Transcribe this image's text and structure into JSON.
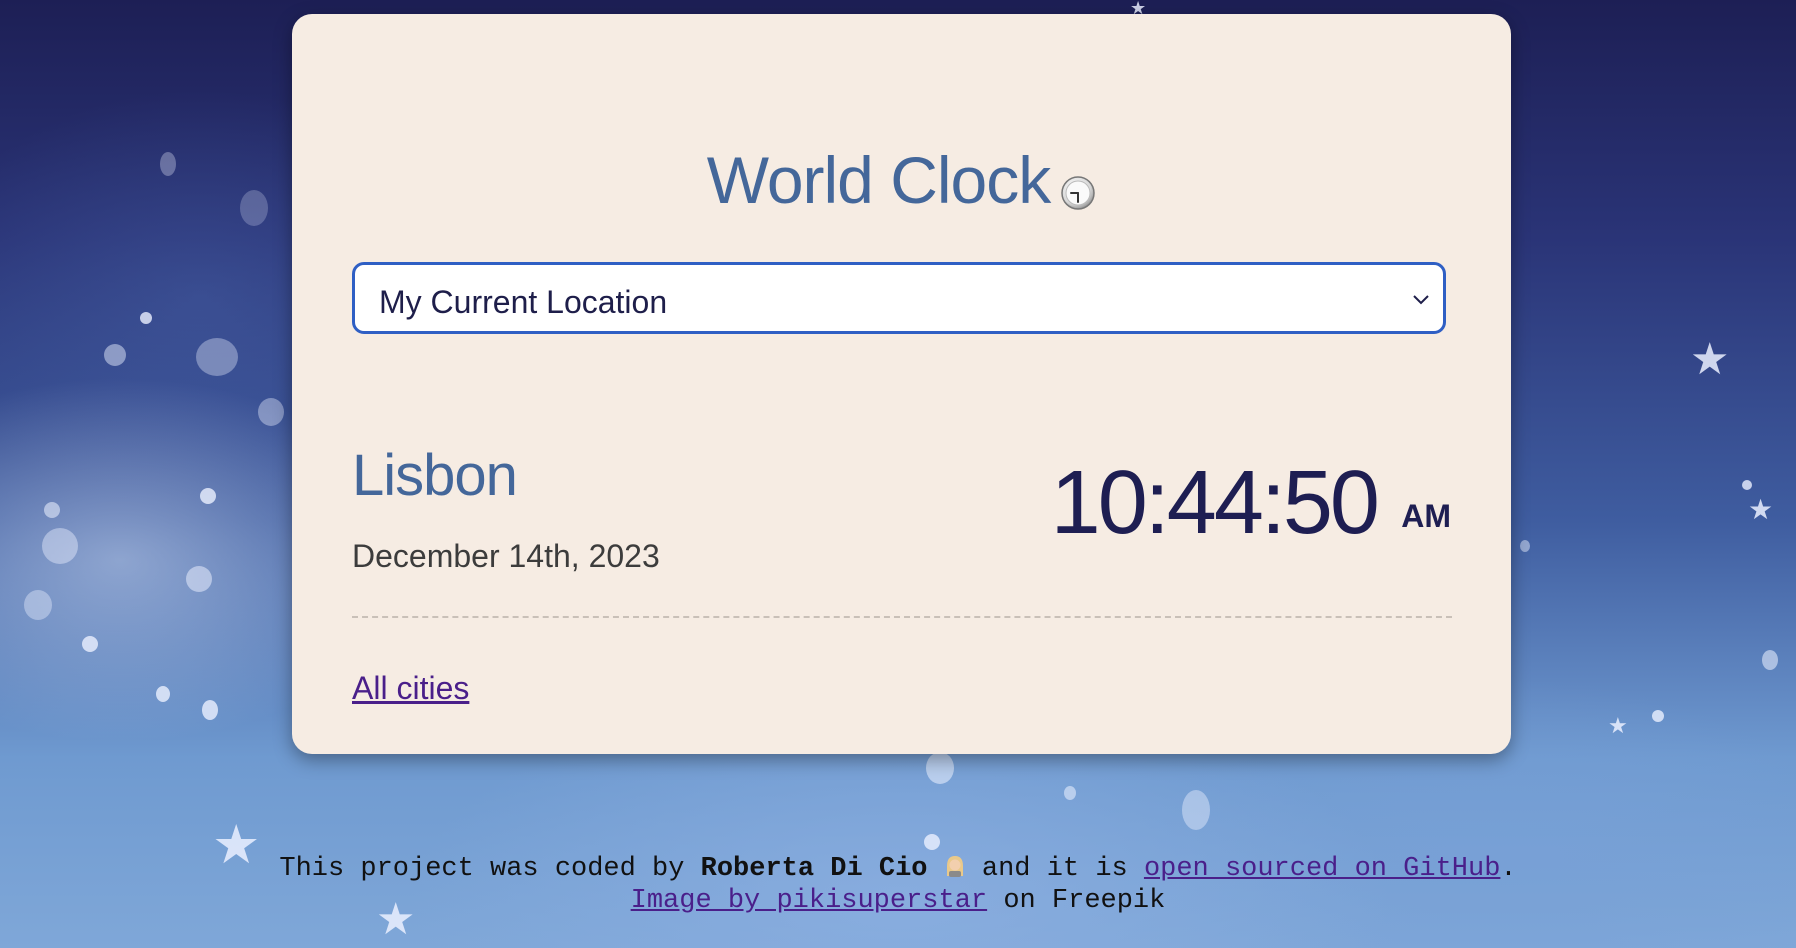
{
  "page": {
    "title": "World Clock",
    "title_icon": "clock-icon",
    "colors": {
      "card_background": "#f6ece3",
      "title": "#44679a",
      "time": "#1e1e52",
      "select_border": "#2f5fc4",
      "link": "#4a1f8a"
    }
  },
  "city_select": {
    "selected": "My Current Location",
    "icon": "chevron-down-icon"
  },
  "clock": {
    "city": "Lisbon",
    "date": "December 14th, 2023",
    "time": "10:44:50",
    "ampm": "AM"
  },
  "nav": {
    "all_cities": "All cities"
  },
  "footer": {
    "line1_prefix": "This project was coded by",
    "author": "Roberta Di Cio",
    "author_icon": "person-emoji-icon",
    "line1_middle": "and it is",
    "github_link": "open sourced on GitHub",
    "line1_suffix": ".",
    "image_credit_link": "Image by pikisuperstar",
    "line2_suffix": "on Freepik"
  }
}
